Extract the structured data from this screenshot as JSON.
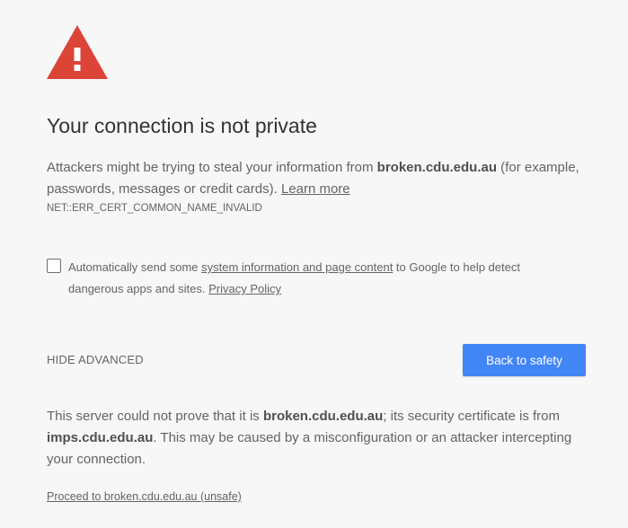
{
  "heading": "Your connection is not private",
  "explanation": {
    "part1": "Attackers might be trying to steal your information from ",
    "host": "broken.cdu.edu.au",
    "part2": " (for example, passwords, messages or credit cards). ",
    "learn_more": "Learn more"
  },
  "error_code": "NET::ERR_CERT_COMMON_NAME_INVALID",
  "checkbox": {
    "checked": false,
    "part1": "Automatically send some ",
    "link1": "system information and page content",
    "part2": " to Google to help detect dangerous apps and sites. ",
    "link2": "Privacy Policy"
  },
  "hide_advanced": "HIDE ADVANCED",
  "back_button": "Back to safety",
  "details": {
    "part1": "This server could not prove that it is ",
    "host": "broken.cdu.edu.au",
    "part2": "; its security certificate is from ",
    "cert_host": "imps.cdu.edu.au",
    "part3": ". This may be caused by a misconfiguration or an attacker intercepting your connection."
  },
  "proceed_link": "Proceed to broken.cdu.edu.au (unsafe)",
  "colors": {
    "warning_red": "#db4437",
    "primary_blue": "#4285f4",
    "background": "#f7f7f7"
  },
  "icon": "warning-triangle-icon"
}
